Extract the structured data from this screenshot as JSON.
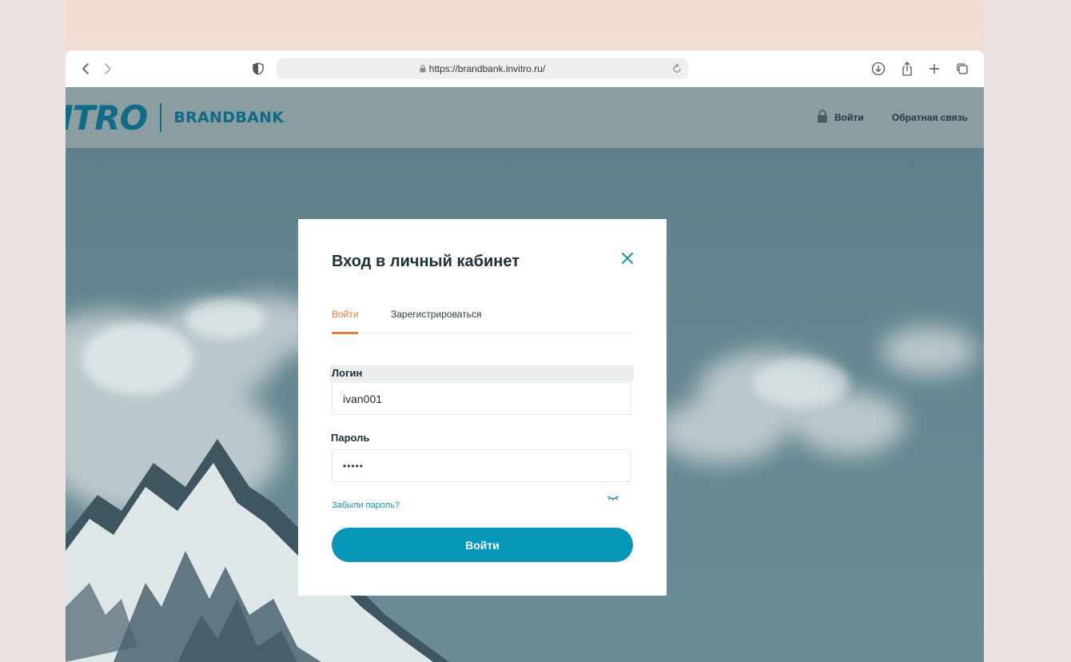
{
  "browser": {
    "url": "https://brandbank.invitro.ru/",
    "icons": {
      "back": "chevron-left-icon",
      "forward": "chevron-right-icon",
      "privacy": "shield-icon",
      "lock": "lock-icon",
      "reload": "reload-icon",
      "download": "download-icon",
      "share": "share-icon",
      "new_tab": "plus-icon",
      "tabs": "tabs-overview-icon"
    }
  },
  "header": {
    "logo_main": "ITRO",
    "logo_sub": "BRANDBANK",
    "login_label": "Войти",
    "feedback_label": "Обратная связь"
  },
  "modal": {
    "title": "Вход в личный кабинет",
    "tabs": [
      {
        "label": "Войти",
        "active": true
      },
      {
        "label": "Зарегистрироваться",
        "active": false
      }
    ],
    "login_label": "Логин",
    "login_value": "ivan001",
    "password_label": "Пароль",
    "password_value": "•••••",
    "forgot_label": "Забыли пароль?",
    "submit_label": "Войти"
  },
  "colors": {
    "accent_orange": "#ef7d3a",
    "primary_button": "#0797b9",
    "brand_teal": "#0f6b86",
    "link": "#1a8fae"
  }
}
